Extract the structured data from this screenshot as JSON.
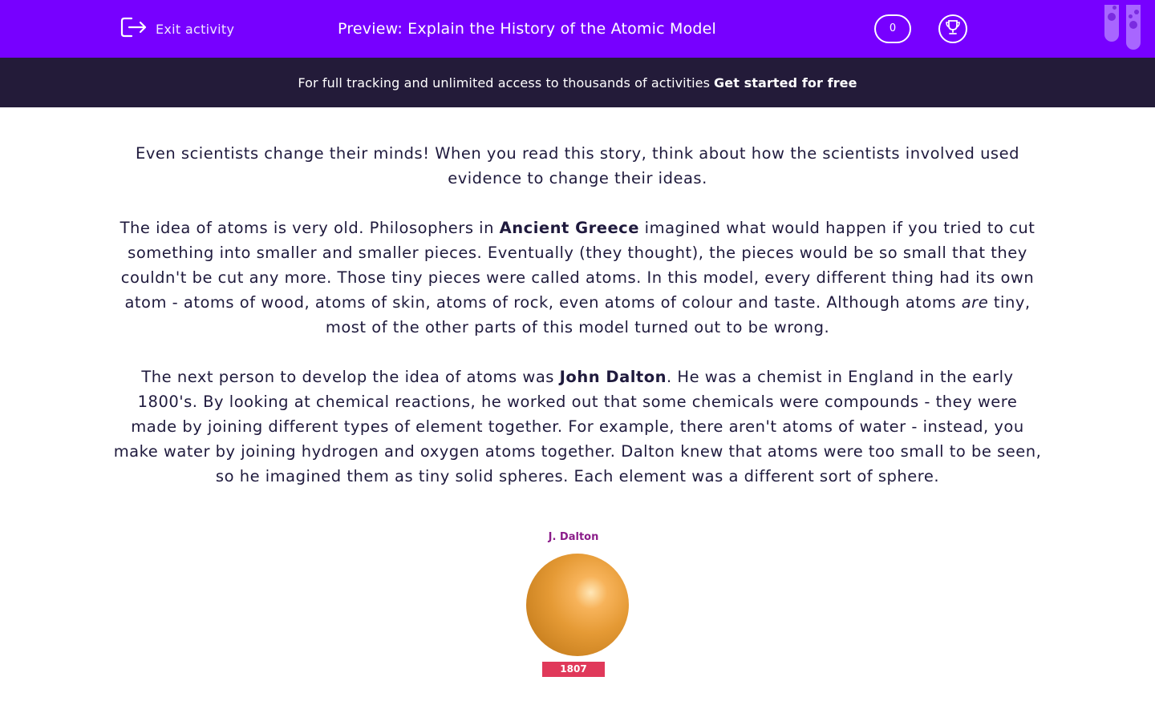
{
  "header": {
    "exit_label": "Exit activity",
    "title": "Preview: Explain the History of the Atomic Model",
    "score": "0"
  },
  "promo": {
    "text": "For full tracking and unlimited access to thousands of activities",
    "cta": "Get started for free"
  },
  "article": {
    "p1": "Even scientists change their minds! When you read this story, think about how the scientists involved used evidence to change their ideas.",
    "p2_a": "The idea of atoms is very old. Philosophers in ",
    "p2_b": "Ancient Greece",
    "p2_c": " imagined what would happen if you tried to cut something into smaller and smaller pieces. Eventually (they thought), the pieces would be so small that they couldn't be cut any more. Those tiny pieces were called atoms. In this model, every different thing had its own atom - atoms of wood, atoms of skin, atoms of rock, even atoms of colour and taste. Although atoms ",
    "p2_d": "are",
    "p2_e": " tiny, most of the other parts of this model turned out to be wrong.",
    "p3_a": "The next person to develop the idea of atoms was ",
    "p3_b": "John Dalton",
    "p3_c": ". He was a chemist in England in the early 1800's. By looking at chemical reactions, he worked out that some chemicals were compounds - they were made by joining different types of element together. For example, there aren't atoms of water - instead, you make water by joining hydrogen and oxygen atoms together. Dalton knew that atoms were too small to be seen, so he imagined them as tiny solid spheres. Each element was a different sort of sphere."
  },
  "figure": {
    "name": "J. Dalton",
    "year": "1807"
  },
  "colors": {
    "header_bg": "#7700ff",
    "promo_bg": "#231b39",
    "body_text": "#1f1a3d",
    "year_badge": "#e0395a",
    "figure_name": "#8b1d8a"
  },
  "icons": {
    "exit": "exit-icon",
    "trophy": "trophy-icon",
    "logo": "test-tubes-logo-icon"
  }
}
